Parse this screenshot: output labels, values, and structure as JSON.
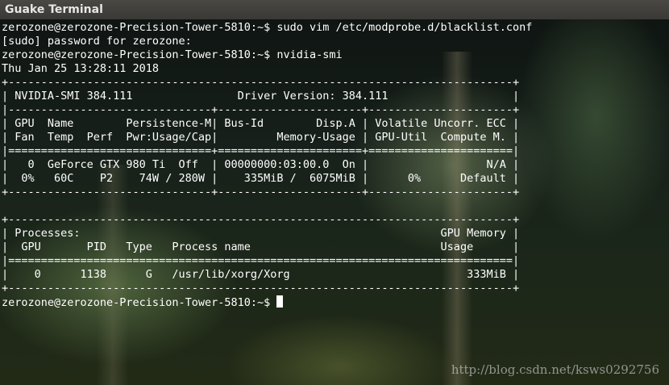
{
  "window": {
    "title": "Guake Terminal"
  },
  "terminal": {
    "lines": [
      "zerozone@zerozone-Precision-Tower-5810:~$ sudo vim /etc/modprobe.d/blacklist.conf",
      "[sudo] password for zerozone:",
      "zerozone@zerozone-Precision-Tower-5810:~$ nvidia-smi",
      "Thu Jan 25 13:28:11 2018",
      "+-----------------------------------------------------------------------------+",
      "| NVIDIA-SMI 384.111                Driver Version: 384.111                   |",
      "|-------------------------------+----------------------+----------------------+",
      "| GPU  Name        Persistence-M| Bus-Id        Disp.A | Volatile Uncorr. ECC |",
      "| Fan  Temp  Perf  Pwr:Usage/Cap|         Memory-Usage | GPU-Util  Compute M. |",
      "|===============================+======================+======================|",
      "|   0  GeForce GTX 980 Ti  Off  | 00000000:03:00.0  On |                  N/A |",
      "|  0%   60C    P2    74W / 280W |    335MiB /  6075MiB |      0%      Default |",
      "+-------------------------------+----------------------+----------------------+",
      "",
      "+-----------------------------------------------------------------------------+",
      "| Processes:                                                       GPU Memory |",
      "|  GPU       PID   Type   Process name                             Usage      |",
      "|=============================================================================|",
      "|    0      1138      G   /usr/lib/xorg/Xorg                           333MiB |",
      "+-----------------------------------------------------------------------------+"
    ],
    "prompt": "zerozone@zerozone-Precision-Tower-5810:~$ "
  },
  "watermark": "http://blog.csdn.net/ksws0292756"
}
